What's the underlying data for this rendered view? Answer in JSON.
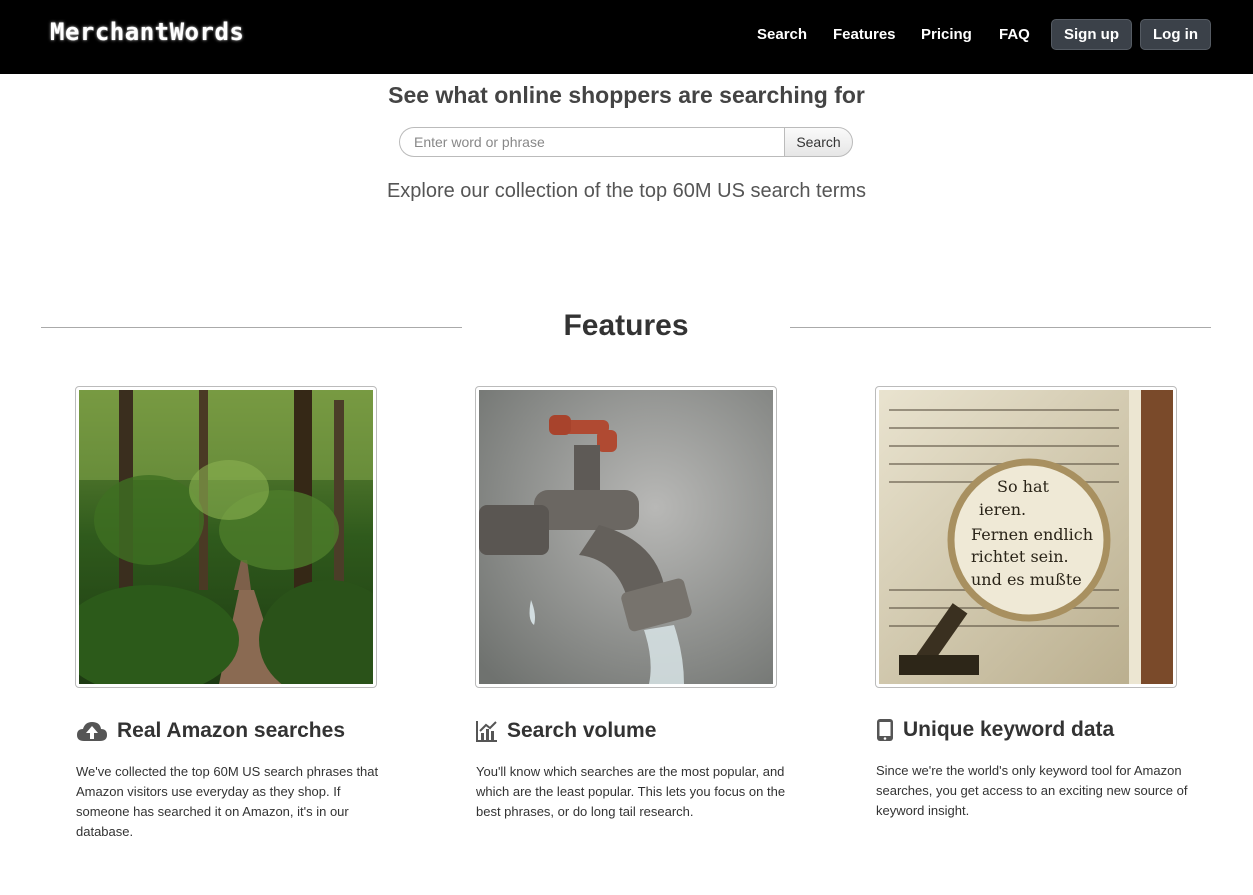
{
  "brand": {
    "name": "MerchantWords"
  },
  "nav": {
    "links": [
      "Search",
      "Features",
      "Pricing",
      "FAQ"
    ],
    "signup_label": "Sign up",
    "login_label": "Log in"
  },
  "hero": {
    "title": "See what online shoppers are searching for",
    "search_placeholder": "Enter word or phrase",
    "search_button": "Search",
    "subtitle": "Explore our collection of the top 60M US search terms"
  },
  "features": {
    "heading": "Features",
    "items": [
      {
        "icon": "cloud-upload-icon",
        "image": "forest-path-photo",
        "title": "Real Amazon searches",
        "text": "We've collected the top 60M US search phrases that Amazon visitors use everyday as they shop. If someone has searched it on Amazon, it's in our database."
      },
      {
        "icon": "bar-chart-icon",
        "image": "faucet-photo",
        "title": "Search volume",
        "text": "You'll know which searches are the most popular, and which are the least popular. This lets you focus on the best phrases, or do long tail research."
      },
      {
        "icon": "mobile-phone-icon",
        "image": "magnifying-glass-book-photo",
        "title": "Unique keyword data",
        "text": "Since we're the world's only keyword tool for Amazon searches, you get access to an exciting new source of keyword insight."
      }
    ]
  },
  "colors": {
    "navbar": "#000000",
    "button": "#3b4149",
    "text": "#333333"
  }
}
